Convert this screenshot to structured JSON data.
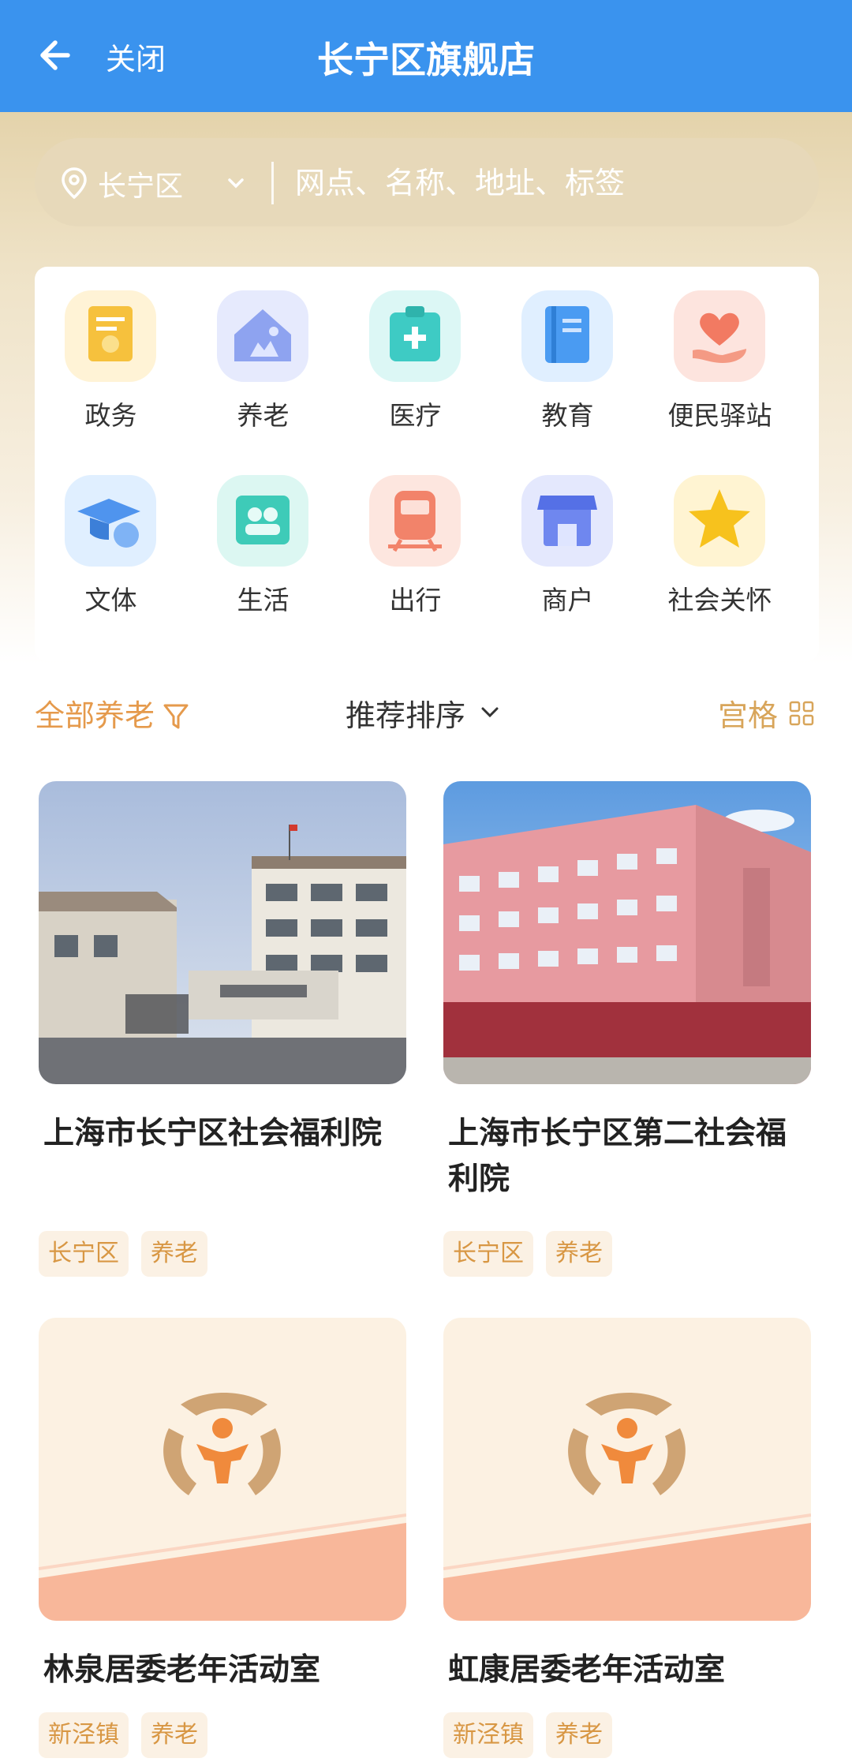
{
  "header": {
    "back_icon": "arrow-left-icon",
    "close_label": "关闭",
    "title": "长宁区旗舰店"
  },
  "search": {
    "region": "长宁区",
    "placeholder": "网点、名称、地址、标签"
  },
  "categories": [
    {
      "label": "政务",
      "icon": "certificate-icon",
      "color": "#f6c13d"
    },
    {
      "label": "养老",
      "icon": "house-icon",
      "color": "#8ea3f0"
    },
    {
      "label": "医疗",
      "icon": "medical-kit-icon",
      "color": "#3ecbc4"
    },
    {
      "label": "教育",
      "icon": "book-icon",
      "color": "#4a9bf2"
    },
    {
      "label": "便民驿站",
      "icon": "heart-hand-icon",
      "color": "#f27a62"
    },
    {
      "label": "文体",
      "icon": "graduation-cap-icon",
      "color": "#4f94ee"
    },
    {
      "label": "生活",
      "icon": "people-icon",
      "color": "#3ecbb8"
    },
    {
      "label": "出行",
      "icon": "train-icon",
      "color": "#f2836a"
    },
    {
      "label": "商户",
      "icon": "shop-icon",
      "color": "#6f87ef"
    },
    {
      "label": "社会关怀",
      "icon": "star-icon",
      "color": "#f7c21d"
    }
  ],
  "filter": {
    "all_label": "全部养老",
    "sort_label": "推荐排序",
    "grid_label": "宫格"
  },
  "cards": [
    {
      "name": "上海市长宁区社会福利院",
      "tags": [
        "长宁区",
        "养老"
      ],
      "image": "building-photo"
    },
    {
      "name": "上海市长宁区第二社会福利院",
      "tags": [
        "长宁区",
        "养老"
      ],
      "image": "pink-building-photo"
    },
    {
      "name": "林泉居委老年活动室",
      "tags": [
        "新泾镇",
        "养老"
      ],
      "image": "placeholder-logo"
    },
    {
      "name": "虹康居委老年活动室",
      "tags": [
        "新泾镇",
        "养老"
      ],
      "image": "placeholder-logo"
    }
  ],
  "colors": {
    "header": "#3a93ee",
    "accent": "#e59a4c",
    "tag_bg": "#fbf1e4",
    "tag_text": "#d89744"
  }
}
